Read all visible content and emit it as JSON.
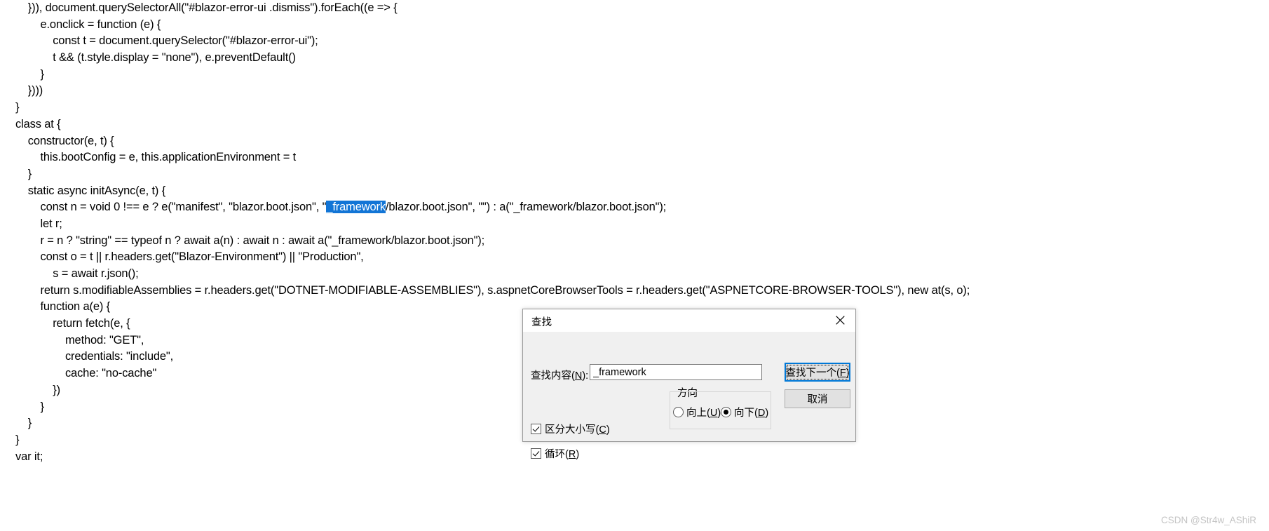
{
  "editor": {
    "name": "text-editor-code-view",
    "selection_text": "_framework",
    "selection_bg": "#1275d6",
    "selection_fg": "#ffffff",
    "lines": [
      {
        "text": "    })), document.querySelectorAll(\"#blazor-error-ui .dismiss\").forEach((e => {"
      },
      {
        "text": "        e.onclick = function (e) {"
      },
      {
        "text": "            const t = document.querySelector(\"#blazor-error-ui\");"
      },
      {
        "text": "            t && (t.style.display = \"none\"), e.preventDefault()"
      },
      {
        "text": "        }"
      },
      {
        "text": "    })))"
      },
      {
        "text": "}"
      },
      {
        "text": "class at {"
      },
      {
        "text": "    constructor(e, t) {"
      },
      {
        "text": "        this.bootConfig = e, this.applicationEnvironment = t"
      },
      {
        "text": "    }"
      },
      {
        "text": "    static async initAsync(e, t) {"
      },
      {
        "before": "        const n = void 0 !== e ? e(\"manifest\", \"blazor.boot.json\", \"",
        "highlight": "_framework",
        "after": "/blazor.boot.json\", \"\") : a(\"_framework/blazor.boot.json\");"
      },
      {
        "text": "        let r;"
      },
      {
        "text": "        r = n ? \"string\" == typeof n ? await a(n) : await n : await a(\"_framework/blazor.boot.json\");"
      },
      {
        "text": "        const o = t || r.headers.get(\"Blazor-Environment\") || \"Production\","
      },
      {
        "text": "            s = await r.json();"
      },
      {
        "text": "        return s.modifiableAssemblies = r.headers.get(\"DOTNET-MODIFIABLE-ASSEMBLIES\"), s.aspnetCoreBrowserTools = r.headers.get(\"ASPNETCORE-BROWSER-TOOLS\"), new at(s, o);"
      },
      {
        "text": "        function a(e) {"
      },
      {
        "text": "            return fetch(e, {"
      },
      {
        "text": "                method: \"GET\","
      },
      {
        "text": "                credentials: \"include\","
      },
      {
        "text": "                cache: \"no-cache\""
      },
      {
        "text": "            })"
      },
      {
        "text": "        }"
      },
      {
        "text": "    }"
      },
      {
        "text": "}"
      },
      {
        "text": "var it;"
      }
    ]
  },
  "find_dialog": {
    "title": "查找",
    "close_icon_label": "×",
    "find_what_label": "查找内容(N):",
    "find_what_label_prefix": "查找内容(",
    "find_what_accel": "N",
    "find_what_label_suffix": "):",
    "find_what_value": "_framework",
    "find_what_placeholder": "",
    "direction": {
      "legend": "方向",
      "options": [
        {
          "label_prefix": "向上(",
          "accel": "U",
          "label_suffix": ")",
          "label": "向上(U)",
          "selected": false
        },
        {
          "label_prefix": "向下(",
          "accel": "D",
          "label_suffix": ")",
          "label": "向下(D)",
          "selected": true
        }
      ]
    },
    "checkboxes": [
      {
        "label_prefix": "区分大小写(",
        "accel": "C",
        "label_suffix": ")",
        "label": "区分大小写(C)",
        "checked": true
      },
      {
        "label_prefix": "循环(",
        "accel": "R",
        "label_suffix": ")",
        "label": "循环(R)",
        "checked": true
      }
    ],
    "buttons": [
      {
        "label_prefix": "查找下一个(",
        "accel": "F",
        "label_suffix": ")",
        "label": "查找下一个(F)",
        "focused": true
      },
      {
        "label_prefix": "取消",
        "accel": "",
        "label_suffix": "",
        "label": "取消",
        "focused": false
      }
    ],
    "accent_color": "#0078d7"
  },
  "watermark": {
    "text": "CSDN @Str4w_AShiR"
  }
}
